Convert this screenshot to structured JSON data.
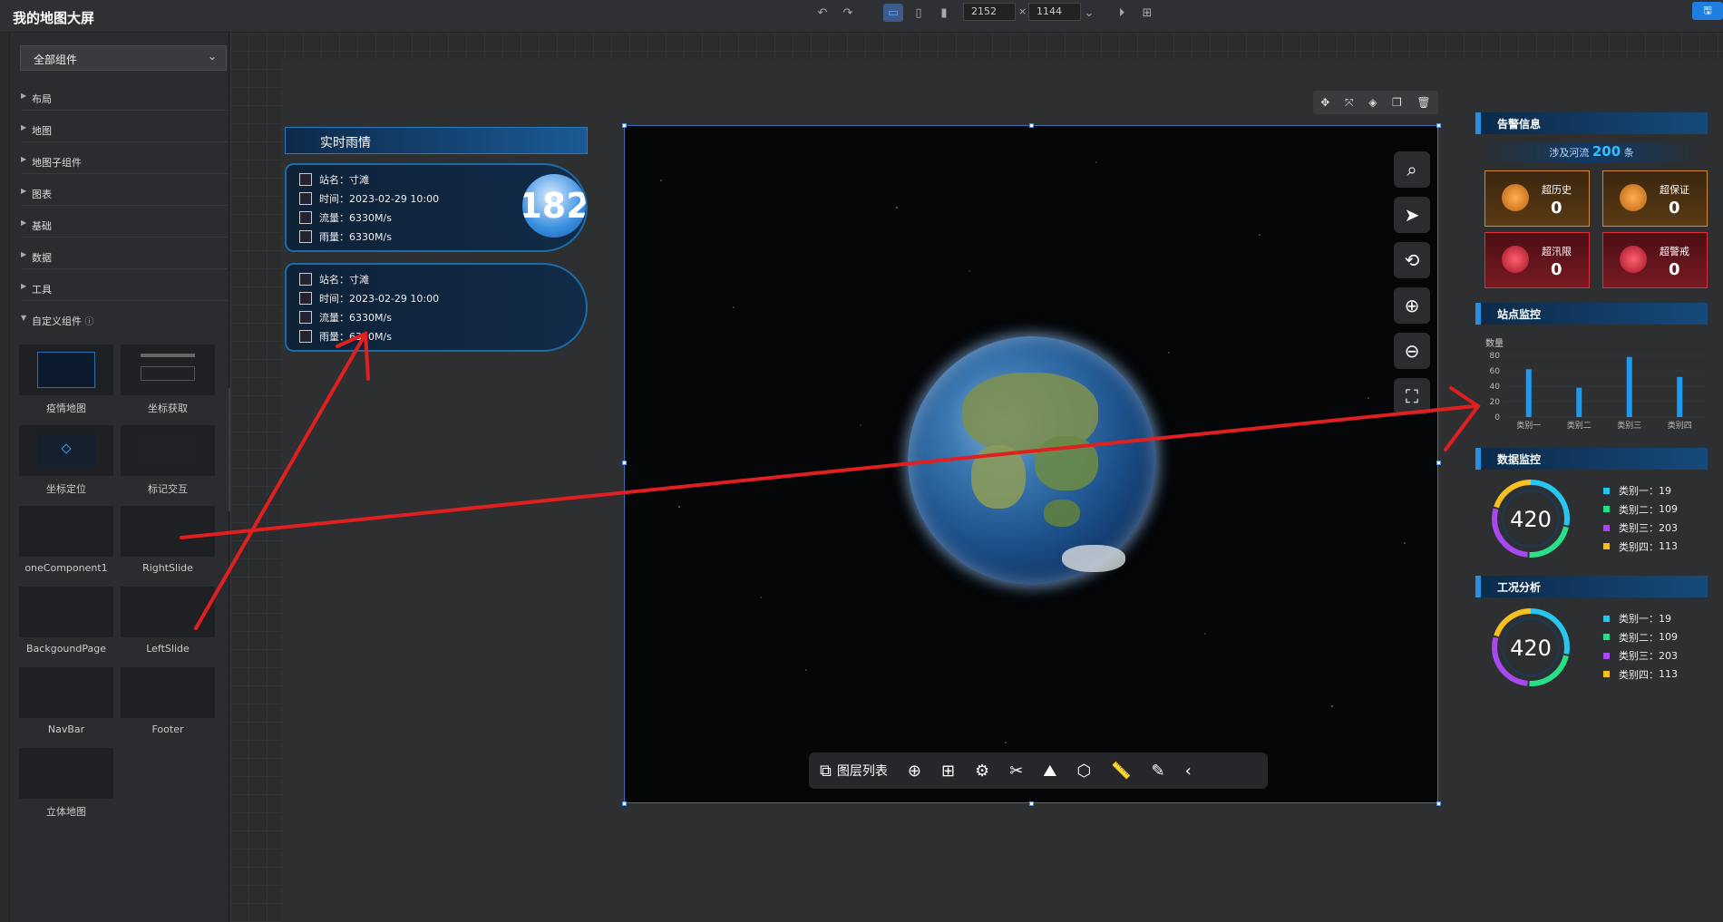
{
  "app": {
    "title": "我的地图大屏"
  },
  "toolbar": {
    "width": "2152",
    "height": "1144",
    "x_sep": "×"
  },
  "sidebar": {
    "dropdown": "全部组件",
    "categories": [
      "布局",
      "地图",
      "地图子组件",
      "图表",
      "基础",
      "数据",
      "工具",
      "自定义组件"
    ],
    "components": [
      "疫情地图",
      "坐标获取",
      "坐标定位",
      "标记交互",
      "oneComponent1",
      "RightSlide",
      "BackgoundPage",
      "LeftSlide",
      "NavBar",
      "Footer",
      "立体地图"
    ]
  },
  "map": {
    "layer_list": "图层列表"
  },
  "rain": {
    "title": "实时雨情",
    "badge": "182",
    "cards": [
      {
        "station": "站名：寸滩",
        "time": "时间：2023-02-29 10:00",
        "flow": "流量：6330M/s",
        "rain": "雨量：6330M/s"
      },
      {
        "station": "站名：寸滩",
        "time": "时间：2023-02-29 10:00",
        "flow": "流量：6330M/s",
        "rain": "雨量：6330M/s"
      }
    ]
  },
  "alerts": {
    "title": "告警信息",
    "river_prefix": "涉及河流",
    "river_count": "200",
    "river_suffix": "条",
    "items": [
      {
        "name": "超历史",
        "value": "0"
      },
      {
        "name": "超保证",
        "value": "0"
      },
      {
        "name": "超汛限",
        "value": "0"
      },
      {
        "name": "超警戒",
        "value": "0"
      }
    ]
  },
  "station": {
    "title": "站点监控",
    "ylabel": "数量"
  },
  "chart_data": {
    "type": "bar",
    "categories": [
      "类别一",
      "类别二",
      "类别三",
      "类别四"
    ],
    "values": [
      62,
      38,
      78,
      52
    ],
    "ylabel": "数量",
    "yticks": [
      "80",
      "60",
      "40",
      "20",
      "0"
    ],
    "ylim": [
      0,
      80
    ]
  },
  "data_monitor": {
    "title": "数据监控",
    "total": "420",
    "legend": [
      "类别一：",
      "类别二：",
      "类别三：",
      "类别四："
    ],
    "values": [
      "19",
      "109",
      "203",
      "113"
    ]
  },
  "work_analysis": {
    "title": "工况分析",
    "total": "420",
    "legend": [
      "类别一：",
      "类别二：",
      "类别三：",
      "类别四："
    ],
    "values": [
      "19",
      "109",
      "203",
      "113"
    ]
  },
  "colors": {
    "cat1": "#27c6f0",
    "cat2": "#29e08a",
    "cat3": "#a848f0",
    "cat4": "#f5c020",
    "arrow": "#e02020"
  }
}
